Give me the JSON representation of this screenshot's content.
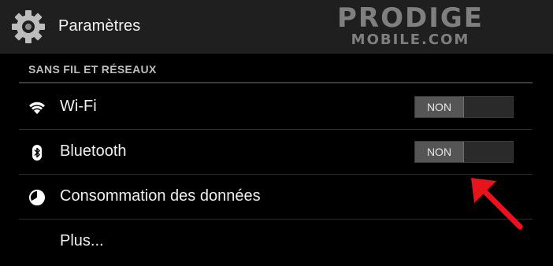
{
  "header": {
    "title": "Paramètres",
    "icon": "gear-icon",
    "watermark": {
      "line1": "PRODIGE",
      "line2": "MOBILE.COM"
    }
  },
  "section": {
    "title": "SANS FIL ET RÉSEAUX"
  },
  "items": [
    {
      "label": "Wi-Fi",
      "icon": "wifi-icon",
      "toggle": "NON"
    },
    {
      "label": "Bluetooth",
      "icon": "bluetooth-icon",
      "toggle": "NON"
    },
    {
      "label": "Consommation des données",
      "icon": "data-usage-icon"
    },
    {
      "label": "Plus..."
    }
  ],
  "colors": {
    "background": "#000000",
    "actionbar": "#1f1f1f",
    "annotation_arrow": "#e8141b"
  }
}
